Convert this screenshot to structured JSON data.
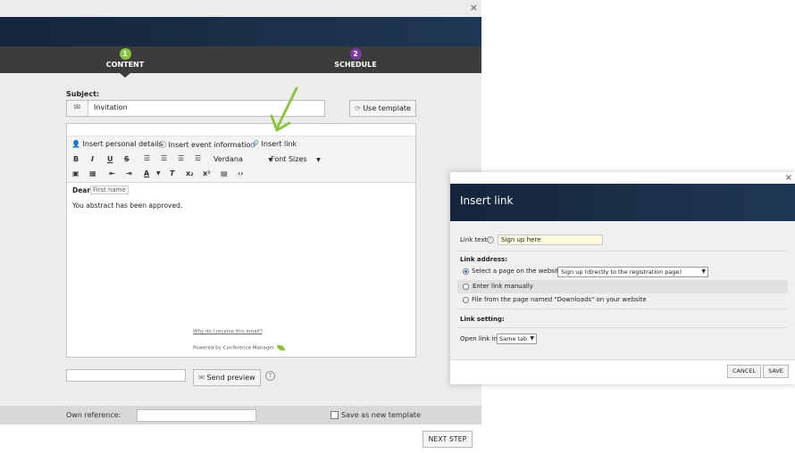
{
  "main_window": {
    "close_label": "×",
    "steps": [
      {
        "number": "1",
        "label": "CONTENT",
        "active": true,
        "color": "#8bc53f"
      },
      {
        "number": "2",
        "label": "SCHEDULE",
        "active": false,
        "color": "#7b3aa0"
      }
    ],
    "subject_label": "Subject:",
    "subject_value": "Invitation",
    "use_template_label": "Use template",
    "editor_toolbar": {
      "insert_personal_details": "Insert personal details",
      "insert_event_information": "Insert event information",
      "insert_link": "Insert link",
      "font_family": "Verdana",
      "font_size": "Font Sizes",
      "buttons_row1": [
        "B",
        "I",
        "U",
        "S"
      ],
      "buttons_row2": [
        "image",
        "table",
        "outdent",
        "indent",
        "font-color",
        "clear-format",
        "subscript",
        "superscript",
        "paste",
        "source"
      ]
    },
    "editor_content": {
      "greeting": "Dear",
      "first_name_placeholder": "First name",
      "body": "You abstract has been approved.",
      "why_link": "Why do I receive this email?",
      "powered_by": "Powered by Conference Manager"
    },
    "send_preview_label": "Send preview",
    "own_reference_label": "Own reference:",
    "own_reference_value": "",
    "save_as_template_label": "Save as new template",
    "save_as_template_checked": false,
    "next_step_label": "NEXT STEP",
    "colors": {
      "header": "#1b2f47",
      "accent_green": "#8bc53f",
      "step2_purple": "#7b3aa0"
    }
  },
  "insert_link_dialog": {
    "title": "Insert link",
    "close_label": "×",
    "link_text_label": "Link text:",
    "link_text_value": "Sign up here",
    "link_address_label": "Link address:",
    "options": [
      {
        "label": "Select a page on the website",
        "selected": true
      },
      {
        "label": "Enter link manually",
        "selected": false
      },
      {
        "label": "File from the page named \"Downloads\" on your website",
        "selected": false
      }
    ],
    "page_select_value": "Sign up (directly to the registration page)",
    "link_setting_label": "Link setting:",
    "open_link_in_label": "Open link in",
    "open_link_in_value": "Same tab",
    "cancel_label": "CANCEL",
    "save_label": "SAVE"
  }
}
